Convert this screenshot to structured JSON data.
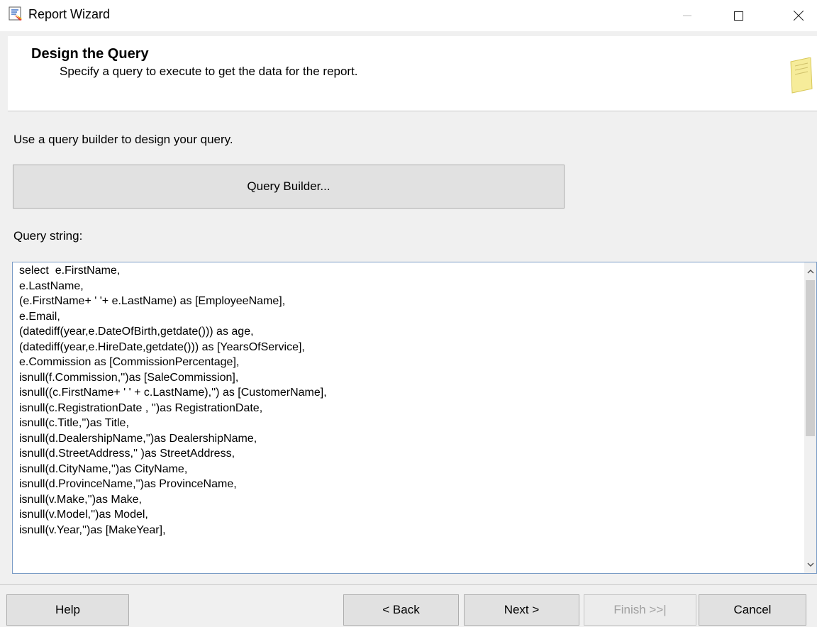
{
  "window": {
    "title": "Report Wizard",
    "minimize_glyph": "—",
    "maximize_glyph": "☐",
    "close_glyph": "✕"
  },
  "header": {
    "title": "Design the Query",
    "subtitle": "Specify a query to execute to get the data for the report."
  },
  "body": {
    "hint": "Use a query builder to design your query.",
    "query_builder_label": "Query Builder...",
    "query_string_label": "Query string:",
    "query_text": "select  e.FirstName,\ne.LastName,\n(e.FirstName+ ' '+ e.LastName) as [EmployeeName],\ne.Email,\n(datediff(year,e.DateOfBirth,getdate())) as age,\n(datediff(year,e.HireDate,getdate())) as [YearsOfService],\ne.Commission as [CommissionPercentage],\nisnull(f.Commission,'')as [SaleCommission],\nisnull((c.FirstName+ ' ' + c.LastName),'') as [CustomerName],\nisnull(c.RegistrationDate , '')as RegistrationDate,\nisnull(c.Title,'')as Title,\nisnull(d.DealershipName,'')as DealershipName,\nisnull(d.StreetAddress,'' )as StreetAddress,\nisnull(d.CityName,'')as CityName,\nisnull(d.ProvinceName,'')as ProvinceName,\nisnull(v.Make,'')as Make,\nisnull(v.Model,'')as Model,\nisnull(v.Year,'')as [MakeYear],"
  },
  "footer": {
    "help_label": "Help",
    "back_label": "< Back",
    "next_label": "Next >",
    "finish_label": "Finish >>|",
    "cancel_label": "Cancel"
  },
  "icons": {
    "app": "report-wizard-icon",
    "header": "note-icon",
    "scroll_up": "chevron-up-icon",
    "scroll_down": "chevron-down-icon"
  },
  "colors": {
    "window_bg": "#f0f0f0",
    "panel_bg": "#ffffff",
    "button_bg": "#e1e1e1",
    "query_border": "#7a9cc6",
    "disabled_text": "#a0a0a0"
  }
}
